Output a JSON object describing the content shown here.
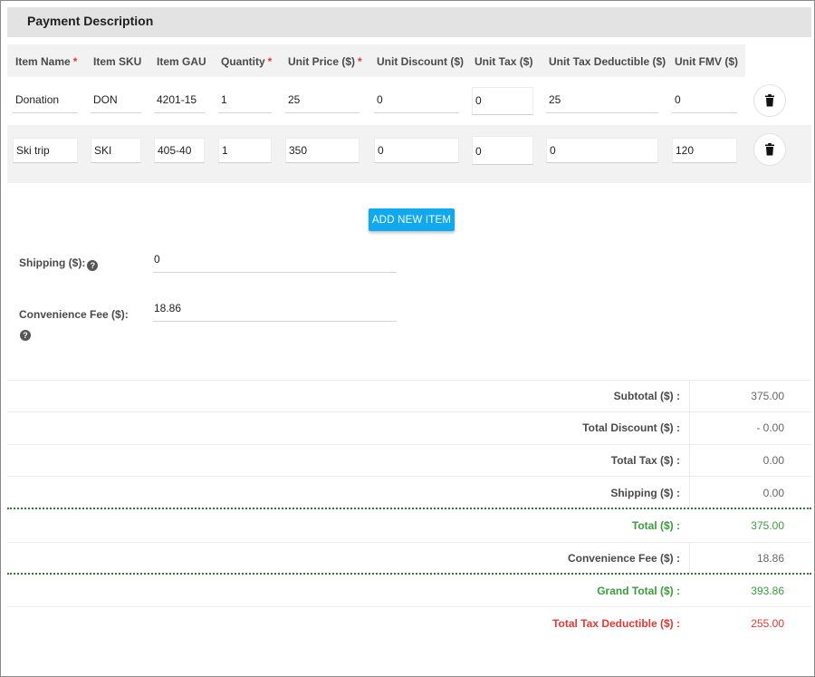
{
  "section": {
    "title": "Payment Description"
  },
  "columns": [
    {
      "label": "Item Name",
      "required": "*"
    },
    {
      "label": "Item SKU",
      "required": ""
    },
    {
      "label": "Item GAU",
      "required": ""
    },
    {
      "label": "Quantity",
      "required": "*"
    },
    {
      "label": "Unit Price ($)",
      "required": "*"
    },
    {
      "label": "Unit Discount ($)",
      "required": ""
    },
    {
      "label": "Unit Tax ($)",
      "required": ""
    },
    {
      "label": "Unit Tax Deductible ($)",
      "required": ""
    },
    {
      "label": "Unit FMV ($)",
      "required": ""
    }
  ],
  "items": [
    {
      "name": "Donation",
      "sku": "DON",
      "gau": "4201-15",
      "quantity": "1",
      "unit_price": "25",
      "unit_discount": "0",
      "unit_tax": "0",
      "unit_tax_deductible": "25",
      "unit_fmv": "0"
    },
    {
      "name": "Ski trip",
      "sku": "SKI",
      "gau": "405-40",
      "quantity": "1",
      "unit_price": "350",
      "unit_discount": "0",
      "unit_tax": "0",
      "unit_tax_deductible": "0",
      "unit_fmv": "120"
    }
  ],
  "add_button": {
    "label": "ADD NEW ITEM"
  },
  "fields": {
    "shipping": {
      "label": "Shipping ($):",
      "value": "0"
    },
    "convenience_fee": {
      "label": "Convenience Fee ($):",
      "value": "18.86"
    }
  },
  "summary": [
    {
      "label": "Subtotal ($) :",
      "value": "375.00"
    },
    {
      "label": "Total Discount ($) :",
      "value": "- 0.00"
    },
    {
      "label": "Total Tax ($) :",
      "value": "0.00"
    },
    {
      "label": "Shipping ($) :",
      "value": "0.00"
    },
    {
      "label": "Total ($) :",
      "value": "375.00"
    },
    {
      "label": "Convenience Fee ($) :",
      "value": "18.86"
    },
    {
      "label": "Grand Total ($) :",
      "value": "393.86"
    },
    {
      "label": "Total Tax Deductible ($) :",
      "value": "255.00"
    }
  ],
  "colors": {
    "accent": "#10a9f0",
    "required": "#e53935",
    "total": "#3c9c3c",
    "deductible": "#e53935"
  },
  "icons": {
    "delete": "trash-icon",
    "help": "help-circle-icon"
  }
}
